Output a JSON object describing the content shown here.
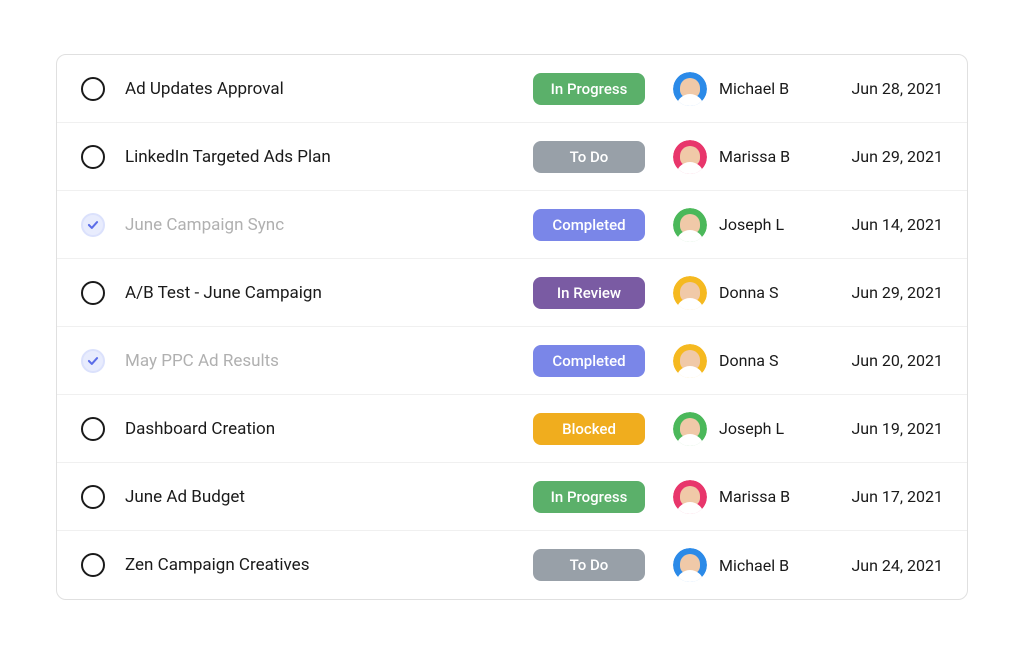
{
  "status_colors": {
    "In Progress": "#5bb06a",
    "To Do": "#98a0a8",
    "Completed": "#7a86e8",
    "In Review": "#7a5ba3",
    "Blocked": "#f0ad1e"
  },
  "avatar_colors": {
    "Michael B": "#2b8ae8",
    "Marissa B": "#e8366b",
    "Joseph L": "#4bb85a",
    "Donna S": "#f5b920"
  },
  "tasks": [
    {
      "title": "Ad Updates Approval",
      "status": "In Progress",
      "assignee": "Michael B",
      "date": "Jun 28, 2021",
      "completed": false
    },
    {
      "title": "LinkedIn Targeted Ads Plan",
      "status": "To Do",
      "assignee": "Marissa B",
      "date": "Jun 29, 2021",
      "completed": false
    },
    {
      "title": "June Campaign Sync",
      "status": "Completed",
      "assignee": "Joseph L",
      "date": "Jun 14, 2021",
      "completed": true
    },
    {
      "title": "A/B Test - June Campaign",
      "status": "In Review",
      "assignee": "Donna S",
      "date": "Jun 29, 2021",
      "completed": false
    },
    {
      "title": "May PPC Ad Results",
      "status": "Completed",
      "assignee": "Donna S",
      "date": "Jun 20, 2021",
      "completed": true
    },
    {
      "title": "Dashboard Creation",
      "status": "Blocked",
      "assignee": "Joseph L",
      "date": "Jun 19, 2021",
      "completed": false
    },
    {
      "title": "June Ad Budget",
      "status": "In Progress",
      "assignee": "Marissa B",
      "date": "Jun 17, 2021",
      "completed": false
    },
    {
      "title": "Zen Campaign Creatives",
      "status": "To Do",
      "assignee": "Michael B",
      "date": "Jun 24, 2021",
      "completed": false
    }
  ]
}
